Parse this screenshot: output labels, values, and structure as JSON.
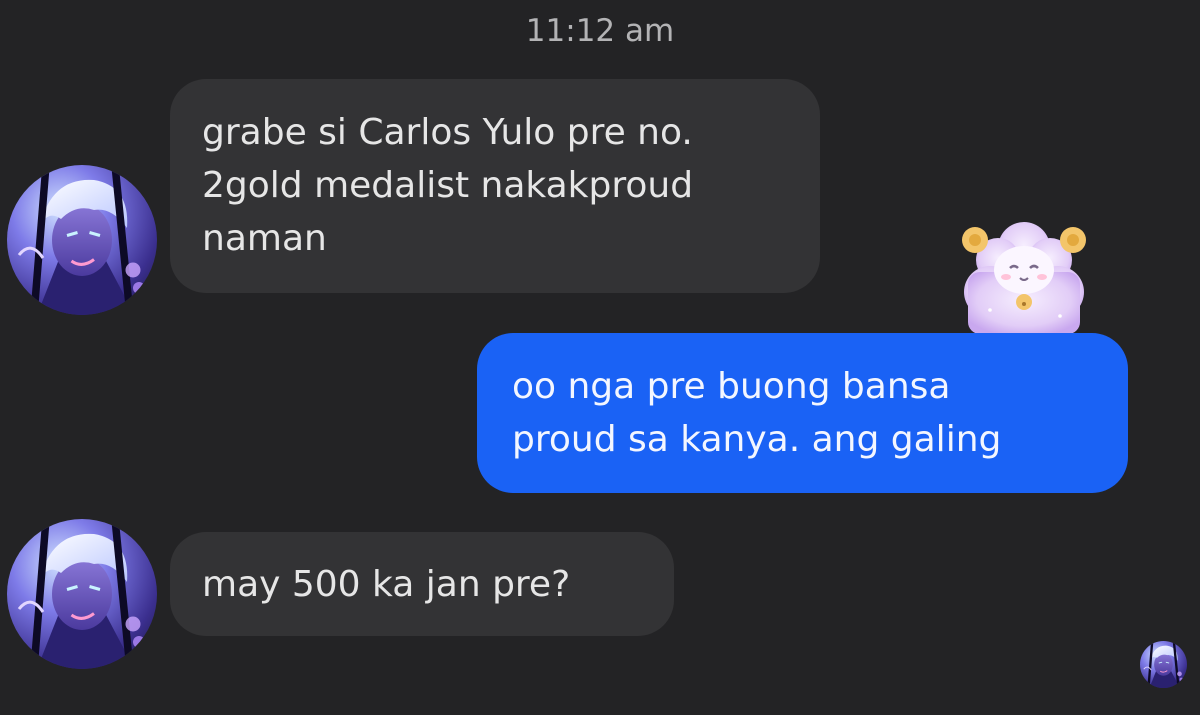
{
  "conversation": {
    "timestamp": "11:12 am",
    "messages": [
      {
        "sender": "other",
        "lines": [
          "grabe si Carlos Yulo pre no.",
          "2gold medalist nakakproud",
          "naman"
        ]
      },
      {
        "sender": "me",
        "lines": [
          "oo nga pre buong bansa",
          "proud sa kanya. ang galing"
        ],
        "reaction_sticker": "pastel-sheep-sticker"
      },
      {
        "sender": "other",
        "lines": [
          "may 500 ka jan pre?"
        ]
      }
    ],
    "read_receipt": "avatar-seen-indicator"
  },
  "colors": {
    "background": "#232325",
    "incoming_bubble": "#333335",
    "outgoing_bubble": "#1a62f5",
    "incoming_text": "#e6e6e6",
    "outgoing_text": "#f3f6ff",
    "timestamp_text": "#b3b3b5"
  }
}
